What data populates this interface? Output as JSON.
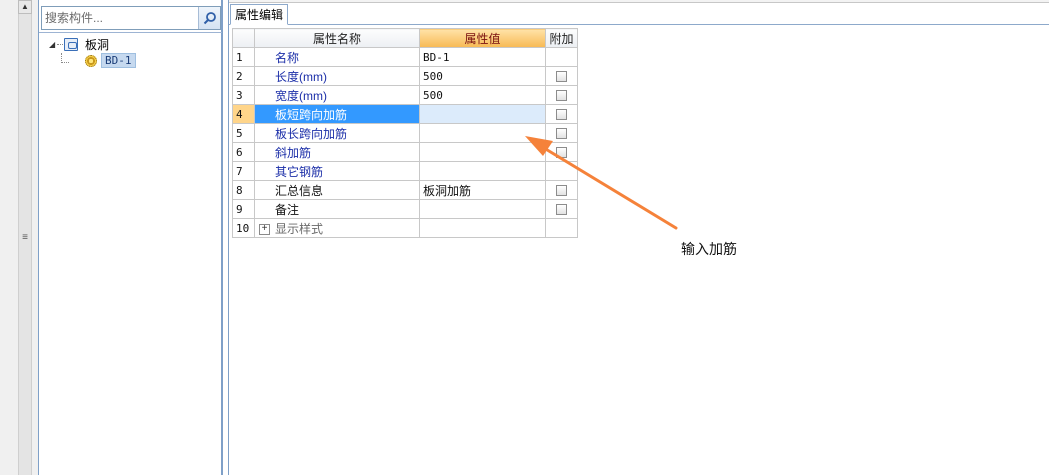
{
  "search": {
    "placeholder": "搜索构件..."
  },
  "tree": {
    "root_label": "板洞",
    "child_label": "BD-1"
  },
  "tabs": [
    {
      "label": "属性编辑"
    }
  ],
  "grid": {
    "headers": {
      "name": "属性名称",
      "value": "属性值",
      "extra": "附加"
    },
    "rows": [
      {
        "index": "1",
        "name": "名称",
        "value": "BD-1",
        "checkbox": false,
        "selected": false
      },
      {
        "index": "2",
        "name": "长度(mm)",
        "value": "500",
        "checkbox": true,
        "selected": false
      },
      {
        "index": "3",
        "name": "宽度(mm)",
        "value": "500",
        "checkbox": true,
        "selected": false
      },
      {
        "index": "4",
        "name": "板短跨向加筋",
        "value": "",
        "checkbox": true,
        "selected": true
      },
      {
        "index": "5",
        "name": "板长跨向加筋",
        "value": "",
        "checkbox": true,
        "selected": false
      },
      {
        "index": "6",
        "name": "斜加筋",
        "value": "",
        "checkbox": true,
        "selected": false
      },
      {
        "index": "7",
        "name": "其它钢筋",
        "value": "",
        "checkbox": false,
        "selected": false
      },
      {
        "index": "8",
        "name": "汇总信息",
        "value": "板洞加筋",
        "checkbox": true,
        "selected": false
      },
      {
        "index": "9",
        "name": "备注",
        "value": "",
        "checkbox": true,
        "selected": false
      },
      {
        "index": "10",
        "name": "显示样式",
        "value": "",
        "checkbox": false,
        "selected": false,
        "expandable": true
      }
    ]
  },
  "annotation": {
    "text": "输入加筋",
    "color": "#f5823a"
  },
  "colors": {
    "selection": "#3399ff",
    "header_accent": "#f7b953",
    "property_blue": "#1b2ea8"
  }
}
